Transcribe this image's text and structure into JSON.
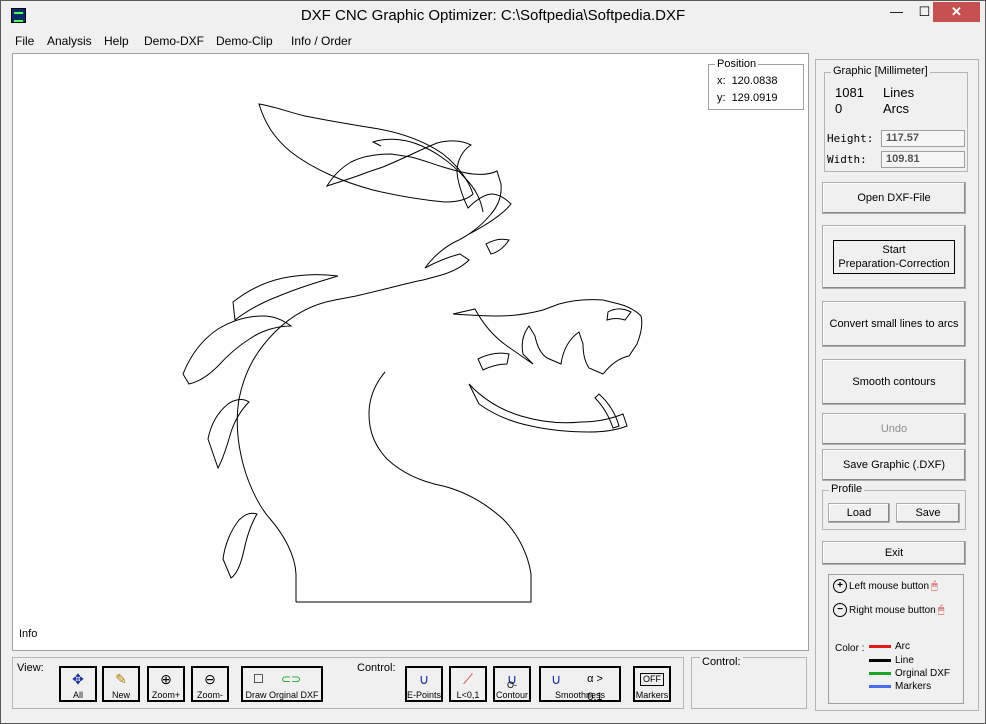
{
  "window": {
    "title": "DXF CNC Graphic Optimizer: C:\\Softpedia\\Softpedia.DXF",
    "min_glyph": "—",
    "max_glyph": "☐",
    "close_glyph": "✕"
  },
  "menu": [
    "File",
    "Analysis",
    "Help",
    "Demo-DXF",
    "Demo-Clip",
    "Info / Order"
  ],
  "position": {
    "legend": "Position",
    "x_label": "x:",
    "x_value": "120.0838",
    "y_label": "y:",
    "y_value": "129.0919"
  },
  "canvas_info": "Info",
  "graphic": {
    "legend": "Graphic [Millimeter]",
    "lines_count": "1081",
    "lines_label": "Lines",
    "arcs_count": "0",
    "arcs_label": "Arcs",
    "height_label": "Height:",
    "height_value": "117.57",
    "width_label": "Width:",
    "width_value": "109.81"
  },
  "buttons": {
    "open": "Open DXF-File",
    "start_line1": "Start",
    "start_line2": "Preparation-Correction",
    "convert": "Convert small lines to arcs",
    "smooth": "Smooth contours",
    "undo": "Undo",
    "save_graphic": "Save Graphic (.DXF)",
    "exit": "Exit"
  },
  "profile": {
    "legend": "Profile",
    "load": "Load",
    "save": "Save"
  },
  "mouse_legend": {
    "left": "Left mouse button",
    "right": "Right mouse button",
    "color_label": "Color :",
    "colors": [
      {
        "name": "Arc",
        "color": "#e11b1b"
      },
      {
        "name": "Line",
        "color": "#000000"
      },
      {
        "name": "Orginal DXF",
        "color": "#1aa52a"
      },
      {
        "name": "Markers",
        "color": "#4a6ef0"
      }
    ]
  },
  "view_bar": {
    "label": "View:",
    "all": "All",
    "new": "New",
    "zoom_plus": "Zoom+",
    "zoom_minus": "Zoom-",
    "draw_original": "Draw Orginal DXF"
  },
  "control_bar": {
    "label": "Control:",
    "epoints": "E-Points",
    "l01": "L<0,1",
    "ocontour": "O-Contour",
    "smoothness": "Smoothness",
    "alpha": "α > 0.1",
    "markers": "Markers",
    "off": "OFF"
  },
  "control_panel2": {
    "label": "Control:"
  }
}
